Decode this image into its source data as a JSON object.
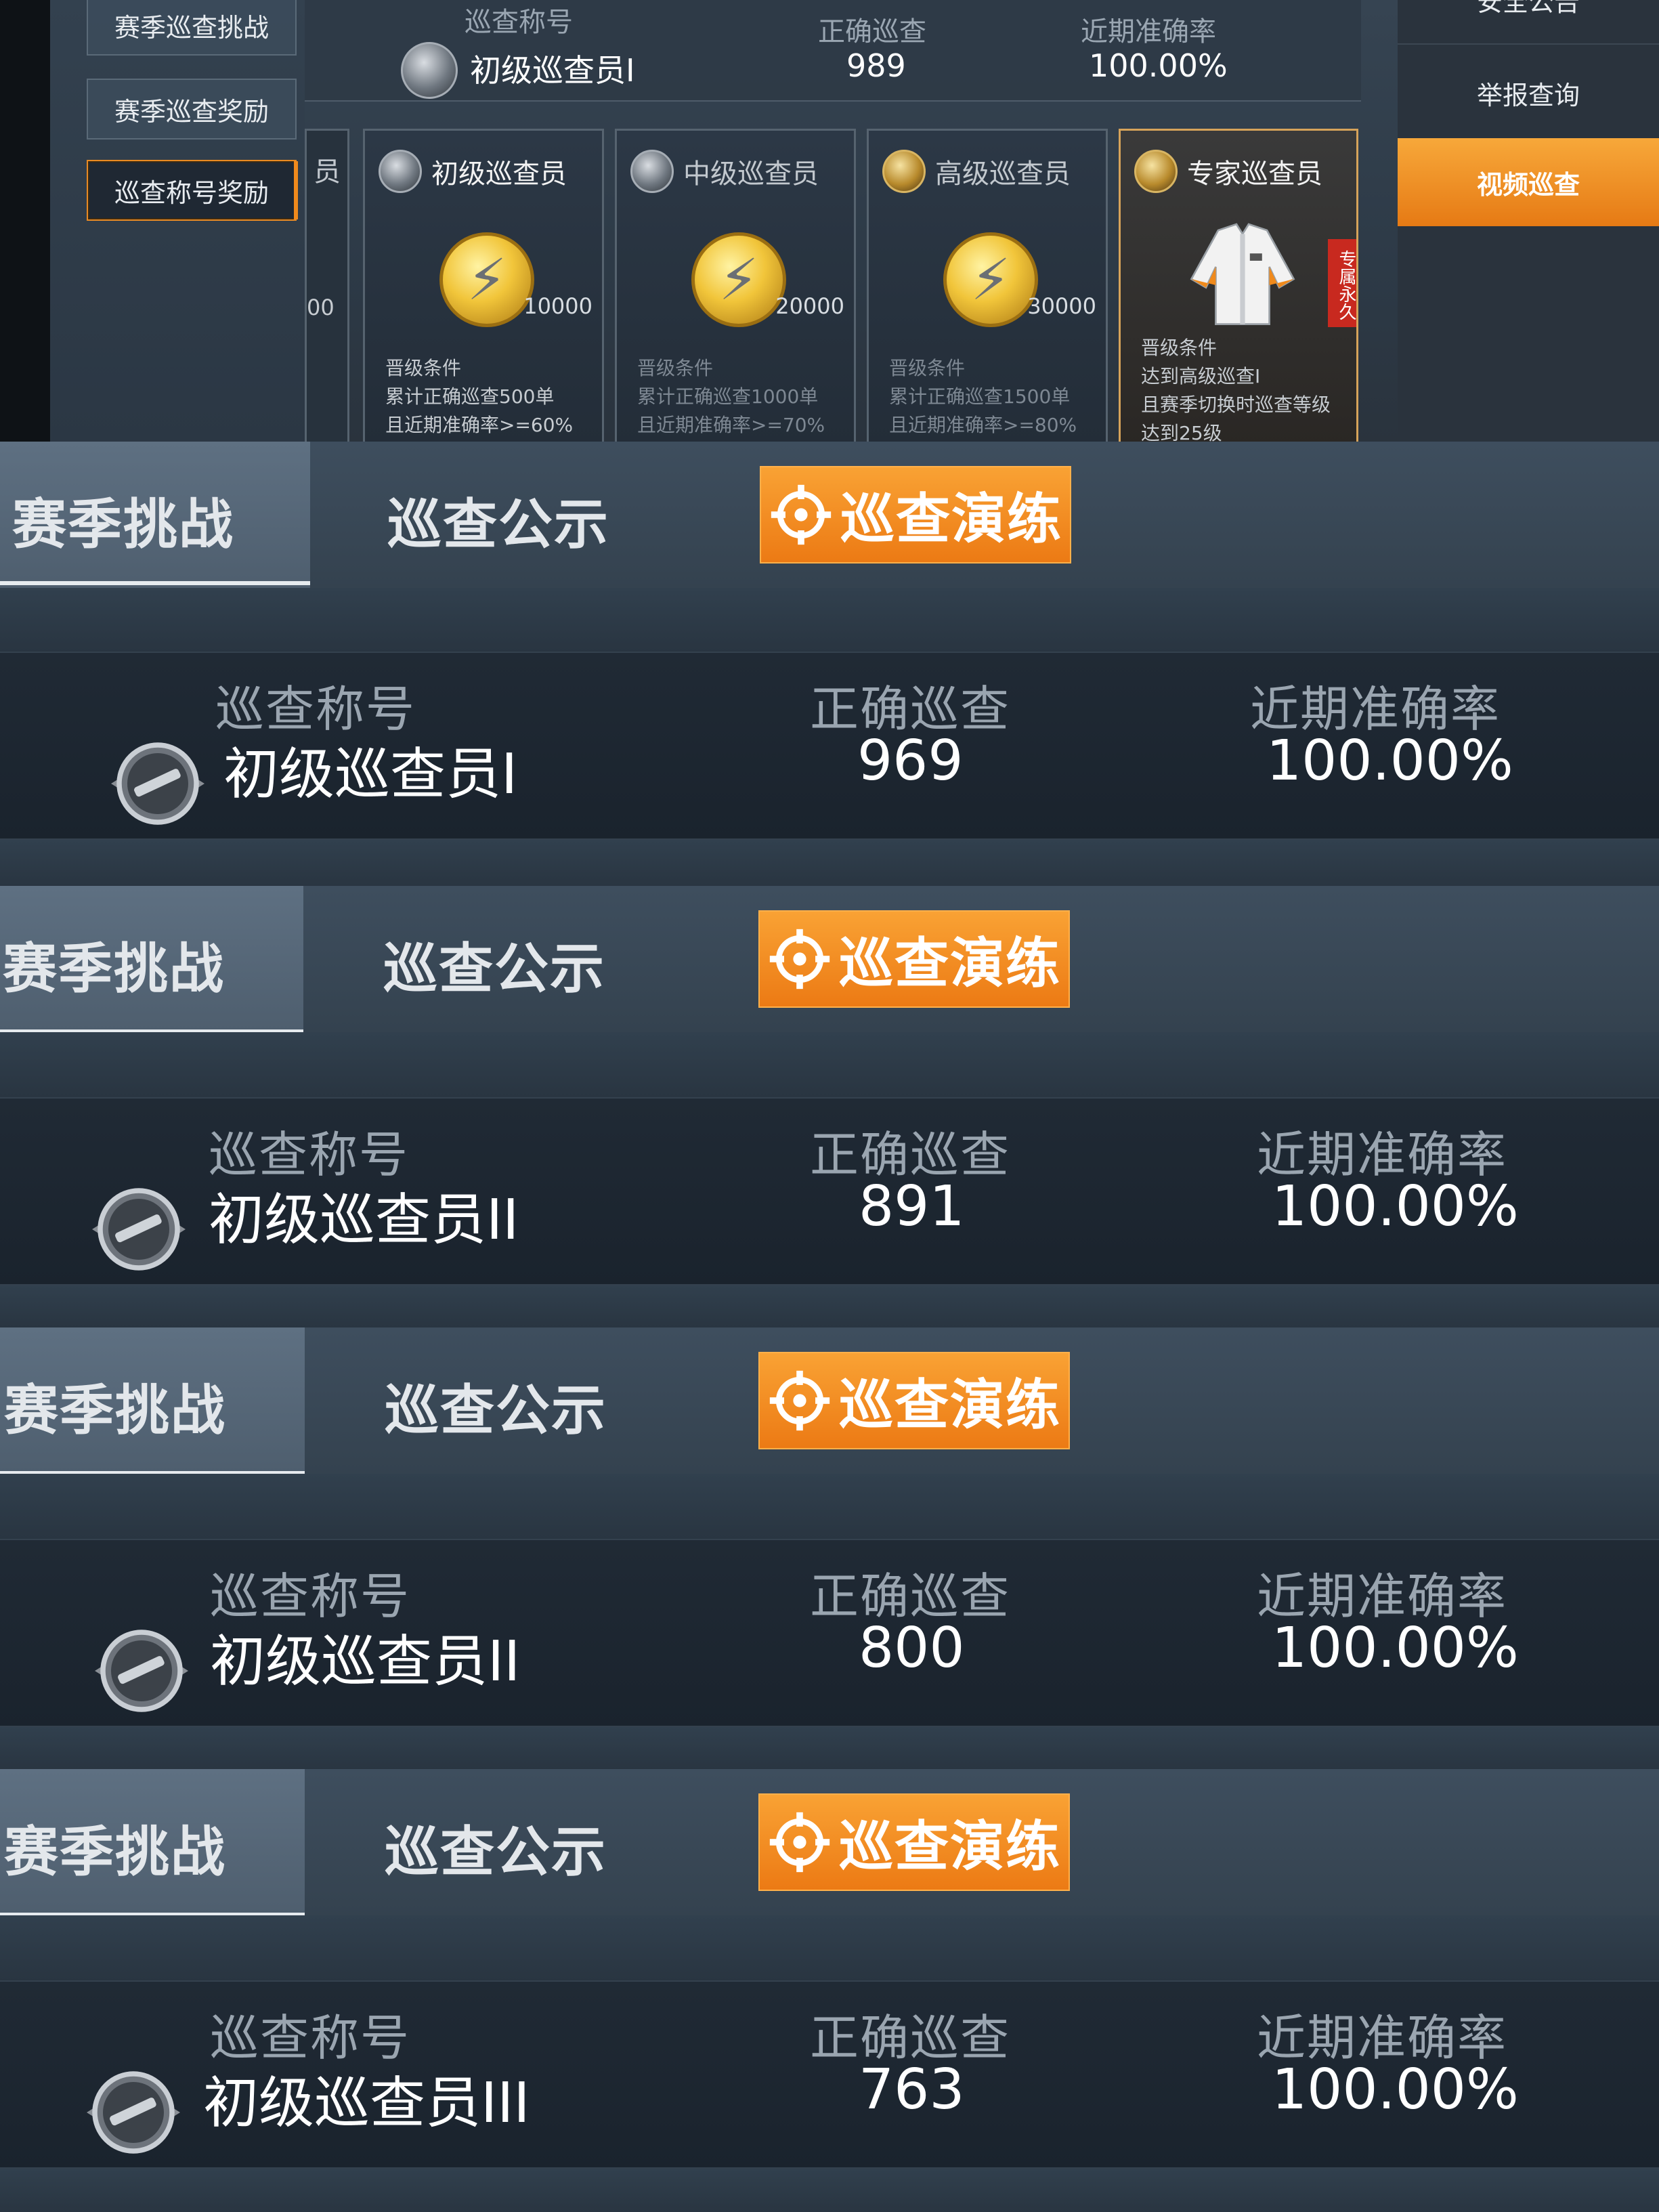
{
  "top_screen": {
    "left_menu": [
      "赛季巡查挑战",
      "赛季巡查奖励",
      "巡查称号奖励"
    ],
    "summary": {
      "title_label": "巡查称号",
      "title_value": "初级巡查员I",
      "correct_label": "正确巡查",
      "correct_value": "989",
      "accuracy_label": "近期准确率",
      "accuracy_value": "100.00%"
    },
    "partial_card": {
      "title": "员",
      "num": "00"
    },
    "cards": [
      {
        "title": "初级巡查员",
        "reward": "10000",
        "cond_head": "晋级条件",
        "cond_1": "累计正确巡查500单",
        "cond_2": "且近期准确率>=60%"
      },
      {
        "title": "中级巡查员",
        "reward": "20000",
        "cond_head": "晋级条件",
        "cond_1": "累计正确巡查1000单",
        "cond_2": "且近期准确率>=70%"
      },
      {
        "title": "高级巡查员",
        "reward": "30000",
        "cond_head": "晋级条件",
        "cond_1": "累计正确巡查1500单",
        "cond_2": "且近期准确率>=80%"
      },
      {
        "title": "专家巡查员",
        "tag": "专属永久",
        "cond_head": "晋级条件",
        "cond_1": "达到高级巡查I",
        "cond_2": "且赛季切换时巡查等级",
        "cond_3": "达到25级"
      }
    ],
    "right_menu": [
      "安全公告",
      "举报查询",
      "视频巡查"
    ]
  },
  "tabs": {
    "season": "赛季挑战",
    "notice": "巡查公示",
    "drill": "巡查演练"
  },
  "stat_labels": {
    "title": "巡查称号",
    "correct": "正确巡查",
    "accuracy": "近期准确率"
  },
  "panels": [
    {
      "title": "初级巡查员I",
      "correct": "969",
      "accuracy": "100.00%"
    },
    {
      "title": "初级巡查员II",
      "correct": "891",
      "accuracy": "100.00%"
    },
    {
      "title": "初级巡查员II",
      "correct": "800",
      "accuracy": "100.00%"
    },
    {
      "title": "初级巡查员III",
      "correct": "763",
      "accuracy": "100.00%"
    }
  ],
  "colors": {
    "accent_orange": "#ec7a14",
    "panel_dark": "#1a232d",
    "tab_bg": "#3a4957"
  }
}
